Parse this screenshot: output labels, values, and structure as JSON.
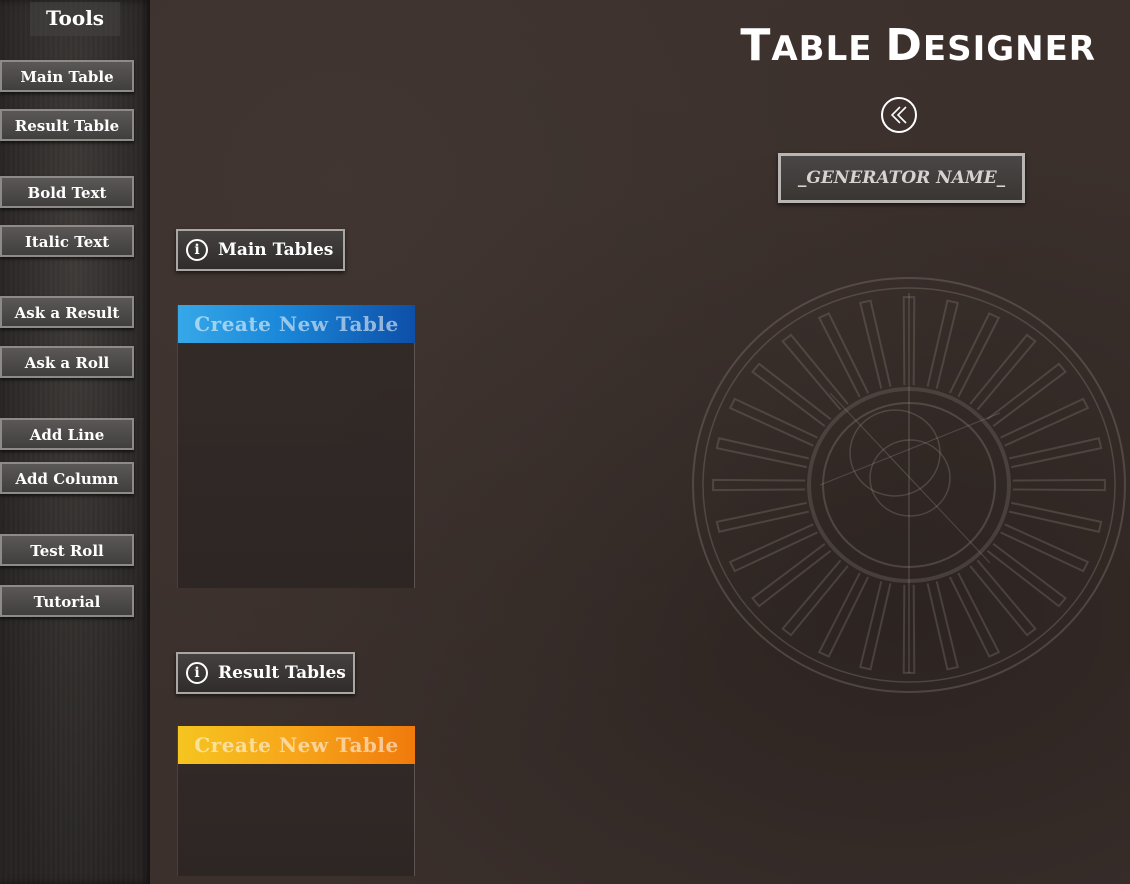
{
  "app": {
    "title_first_big": "T",
    "title_first_rest": "ABLE ",
    "title_second_big": "D",
    "title_second_rest": "ESIGNER",
    "generator_name": "_GENERATOR NAME_"
  },
  "sidebar": {
    "title": "Tools",
    "buttons": [
      {
        "label": "Main Table"
      },
      {
        "label": "Result Table"
      },
      {
        "label": "Bold Text"
      },
      {
        "label": "Italic Text"
      },
      {
        "label": "Ask a Result"
      },
      {
        "label": "Ask a Roll"
      },
      {
        "label": "Add Line"
      },
      {
        "label": "Add Column"
      },
      {
        "label": "Test Roll"
      },
      {
        "label": "Tutorial"
      }
    ]
  },
  "main_tables": {
    "header": "Main Tables",
    "info_glyph": "i",
    "create_label": "Create New Table",
    "color": "#1a86d8"
  },
  "result_tables": {
    "header": "Result Tables",
    "info_glyph": "i",
    "create_label": "Create New Table",
    "color": "#f7a51a"
  },
  "icons": {
    "back": "double-chevron-left-icon",
    "info": "info-icon",
    "compass": "compass-rose-icon"
  }
}
